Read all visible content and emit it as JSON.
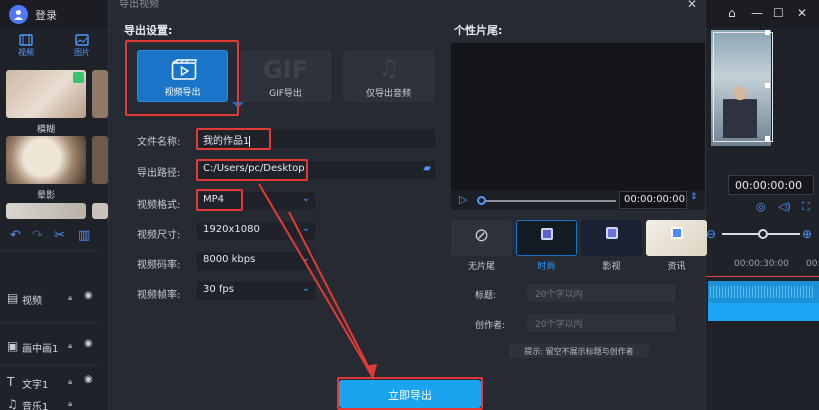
{
  "editor": {
    "login_label": "登录",
    "media_tabs": [
      {
        "label": "视频",
        "icon": "film-icon"
      },
      {
        "label": "图片",
        "icon": "image-icon"
      }
    ],
    "media_items": [
      {
        "label": "模糊"
      },
      {
        "label": "晕影"
      }
    ],
    "tracks": [
      {
        "label": "视频",
        "icon": "video-track-icon"
      },
      {
        "label": "画中画1",
        "icon": "pip-track-icon"
      },
      {
        "label": "文字1",
        "icon": "text-track-icon"
      },
      {
        "label": "音乐1",
        "icon": "music-track-icon"
      }
    ],
    "right_timecode": "00:00:00:00",
    "ruler_labels": [
      "00:00:30:00",
      "00:"
    ]
  },
  "dialog": {
    "title": "导出视频",
    "export_settings_title": "导出设置:",
    "export_modes": [
      {
        "label": "视频导出",
        "icon": "video-export-icon",
        "active": true
      },
      {
        "label": "GIF导出",
        "icon": "gif-icon",
        "active": false
      },
      {
        "label": "仅导出音频",
        "icon": "music-note-icon",
        "active": false
      }
    ],
    "fields": {
      "file_name": {
        "label": "文件名称:",
        "value": "我的作品1"
      },
      "export_path": {
        "label": "导出路径:",
        "value": "C:/Users/pc/Desktop"
      },
      "format": {
        "label": "视频格式:",
        "value": "MP4"
      },
      "size": {
        "label": "视频尺寸:",
        "value": "1920x1080"
      },
      "bitrate": {
        "label": "视频码率:",
        "value": "8000 kbps"
      },
      "framerate": {
        "label": "视频帧率:",
        "value": "30 fps"
      }
    },
    "export_button": "立即导出",
    "preview": {
      "title": "个性片尾:",
      "timecode": "00:00:00:00"
    },
    "endings": [
      {
        "label": "无片尾",
        "icon": "no-ending-icon"
      },
      {
        "label": "时尚",
        "icon": "fashion-ending-icon"
      },
      {
        "label": "影视",
        "icon": "film-ending-icon"
      },
      {
        "label": "资讯",
        "icon": "news-ending-icon"
      }
    ],
    "meta": {
      "title_label": "标题:",
      "title_placeholder": "20个字以内",
      "author_label": "创作者:",
      "author_placeholder": "20个字以内"
    },
    "tip": "提示: 留空不展示标题与创作者"
  },
  "colors": {
    "accent": "#1aa3ee",
    "highlight": "#e53935",
    "panel": "#262a33"
  }
}
